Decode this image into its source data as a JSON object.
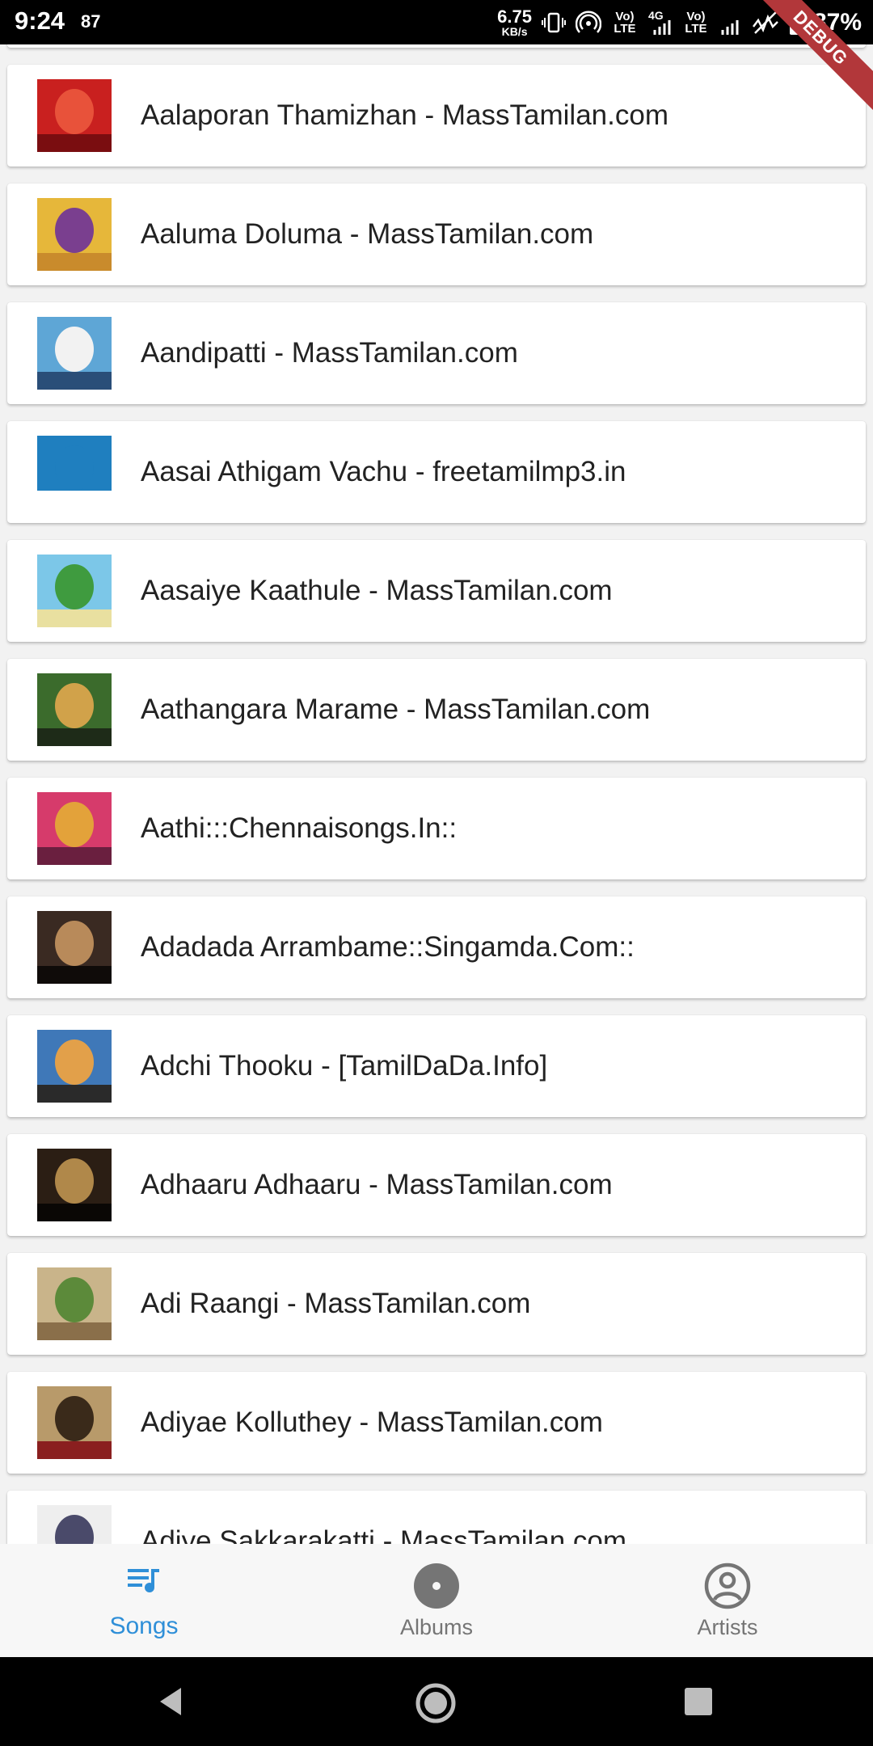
{
  "status_bar": {
    "time": "9:24",
    "notification_count": "87",
    "net_speed_value": "6.75",
    "net_speed_unit": "KB/s",
    "lte1": "Vo) LTE",
    "lte_4g": "4G",
    "lte2": "Vo) LTE",
    "battery_percent": "87%"
  },
  "debug_banner": "DEBUG",
  "songs": [
    {
      "title": "Aalaporan Thamizhan - MassTamilan.com",
      "thumb_colors": [
        "#c9201f",
        "#e8523a",
        "#7a0d10"
      ]
    },
    {
      "title": "Aaluma Doluma - MassTamilan.com",
      "thumb_colors": [
        "#e6b73a",
        "#7a3f8f",
        "#c98b2c"
      ]
    },
    {
      "title": "Aandipatti - MassTamilan.com",
      "thumb_colors": [
        "#5ea6d6",
        "#f2f2f2",
        "#2a4e78"
      ]
    },
    {
      "title": "Aasai Athigam Vachu - freetamilmp3.in",
      "thumb_colors": [
        "#1f7fbf",
        "#1f7fbf",
        "#ffffff"
      ]
    },
    {
      "title": "Aasaiye Kaathule - MassTamilan.com",
      "thumb_colors": [
        "#7cc7e8",
        "#3f9b3f",
        "#e9e0a0"
      ]
    },
    {
      "title": "Aathangara Marame - MassTamilan.com",
      "thumb_colors": [
        "#3b6b2c",
        "#d1a24a",
        "#1e2b18"
      ]
    },
    {
      "title": "Aathi:::Chennaisongs.In::",
      "thumb_colors": [
        "#d63b6b",
        "#e3a23a",
        "#6a1f3f"
      ]
    },
    {
      "title": "Adadada Arrambame::Singamda.Com::",
      "thumb_colors": [
        "#3a2a22",
        "#b88a5a",
        "#0f0b09"
      ]
    },
    {
      "title": "Adchi Thooku - [TamilDaDa.Info]",
      "thumb_colors": [
        "#3f78b8",
        "#e2a04a",
        "#2a2a2a"
      ]
    },
    {
      "title": "Adhaaru Adhaaru - MassTamilan.com",
      "thumb_colors": [
        "#2b1e14",
        "#b0884a",
        "#0a0705"
      ]
    },
    {
      "title": "Adi Raangi - MassTamilan.com",
      "thumb_colors": [
        "#c9b48a",
        "#5c8a3a",
        "#8a6f4a"
      ]
    },
    {
      "title": "Adiyae Kolluthey - MassTamilan.com",
      "thumb_colors": [
        "#b89a6a",
        "#3a2a1a",
        "#8a1f1f"
      ]
    },
    {
      "title": "Adiye Sakkarakatti - MassTamilan.com",
      "thumb_colors": [
        "#eeeeee",
        "#4a4a6a",
        "#c03030"
      ]
    }
  ],
  "bottom_nav": [
    {
      "label": "Songs",
      "icon": "queue-music-icon",
      "active": true
    },
    {
      "label": "Albums",
      "icon": "album-icon",
      "active": false
    },
    {
      "label": "Artists",
      "icon": "account-circle-icon",
      "active": false
    }
  ],
  "system_nav": {
    "back": "back-icon",
    "home": "home-icon",
    "recents": "recents-icon"
  },
  "colors": {
    "accent": "#2f8fd8",
    "inactive": "#757575",
    "debug": "#b2373a"
  }
}
